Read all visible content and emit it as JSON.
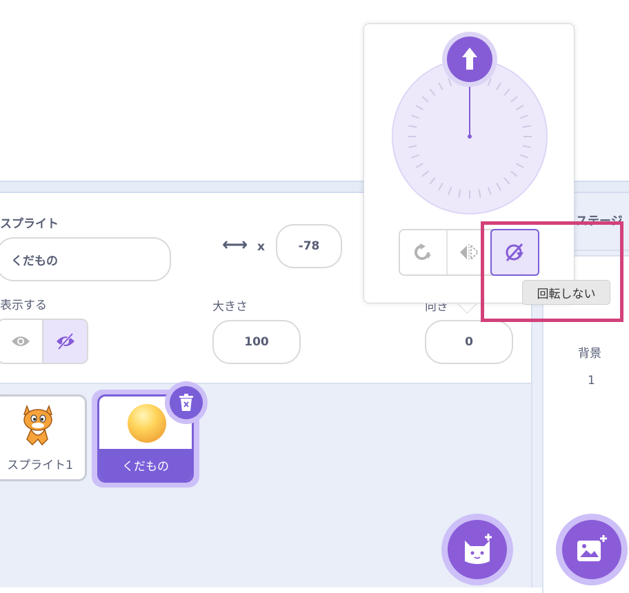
{
  "sprite_info": {
    "sprite_label": "スプライト",
    "sprite_name": "くだもの",
    "x_label": "x",
    "x_value": "-78",
    "show_label": "表示する",
    "size_label": "大きさ",
    "size_value": "100",
    "direction_label": "向き",
    "direction_value": "0"
  },
  "sprites": [
    {
      "name": "スプライト1",
      "selected": false
    },
    {
      "name": "くだもの",
      "selected": true
    }
  ],
  "stage": {
    "header": "ステージ",
    "backdrops_label": "背景",
    "backdrops_count": "1"
  },
  "direction_popover": {
    "rotation_styles": [
      "all-around",
      "left-right",
      "dont-rotate"
    ],
    "selected_style": "dont-rotate",
    "tooltip": "回転しない"
  },
  "colors": {
    "accent": "#855cd6",
    "highlight": "#d2417a"
  }
}
